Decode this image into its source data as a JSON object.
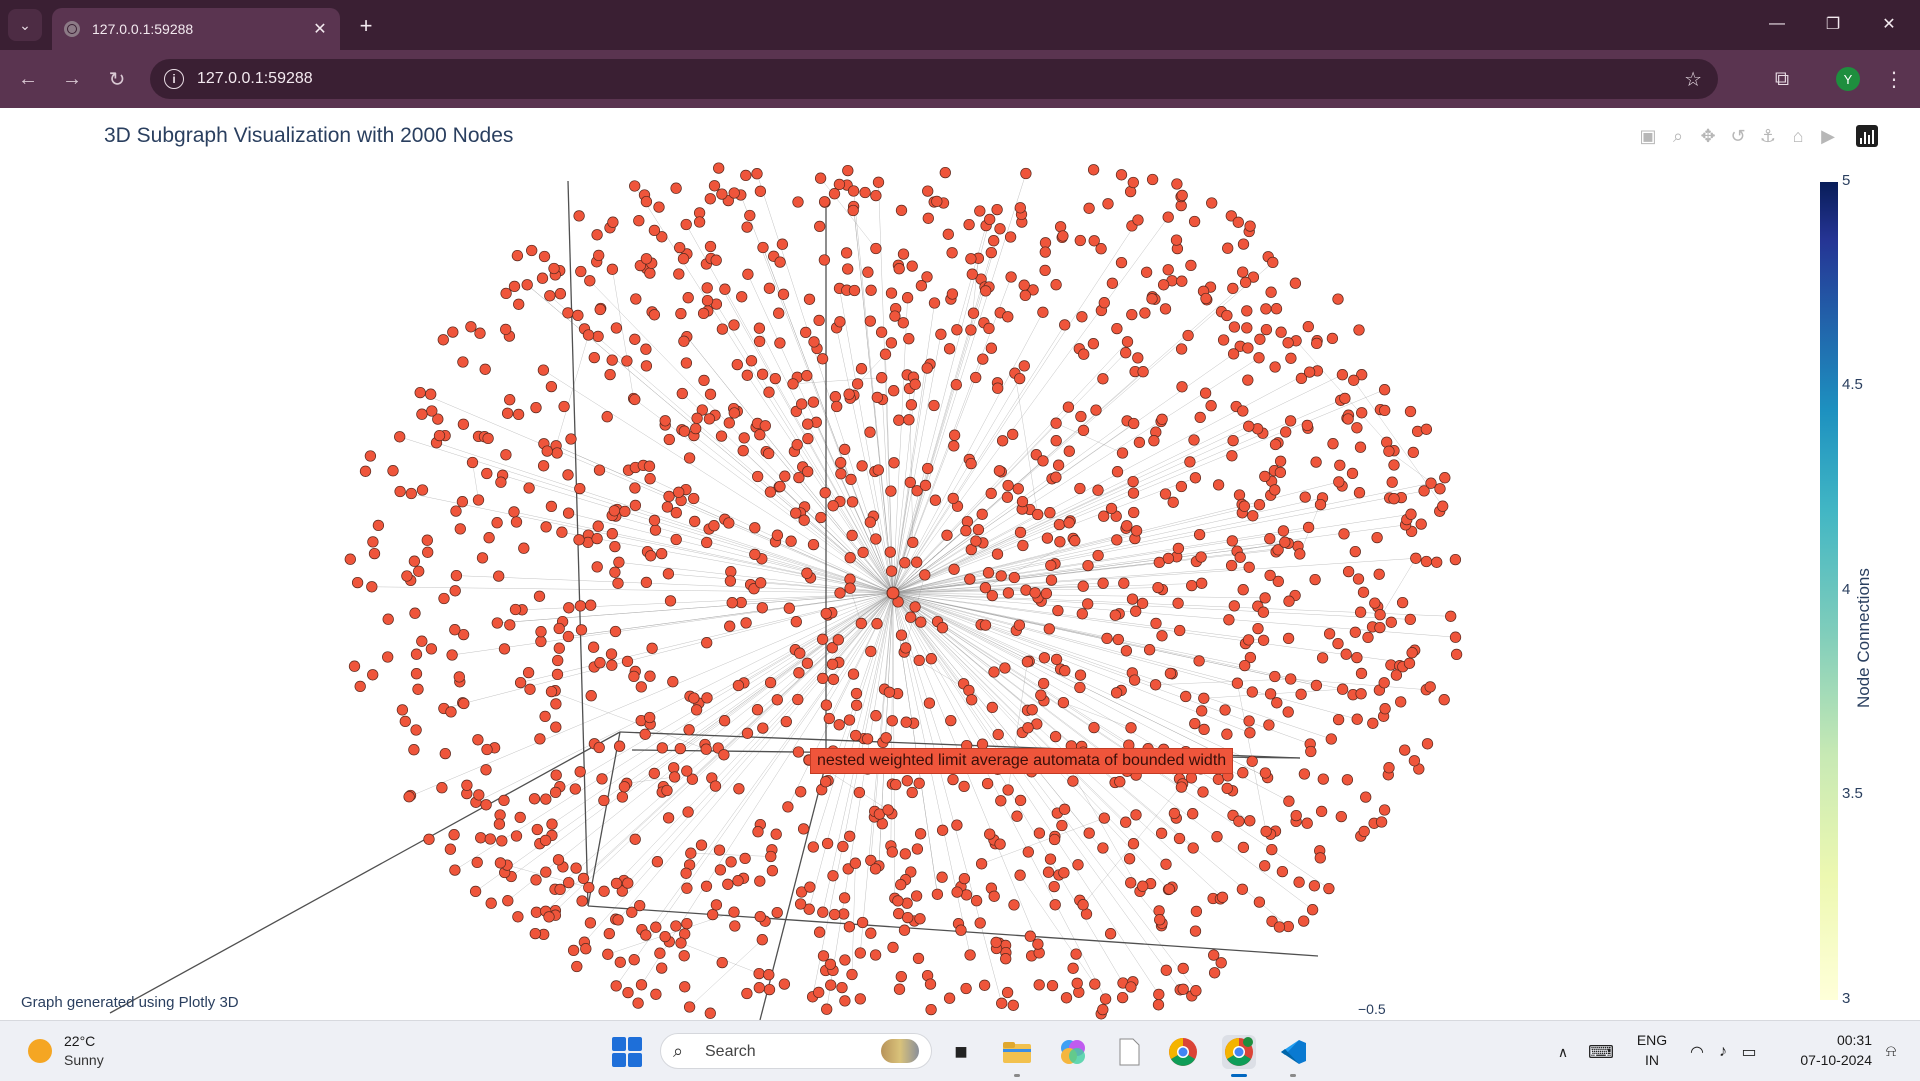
{
  "browser": {
    "tab_title": "127.0.0.1:59288",
    "url": "127.0.0.1:59288",
    "profile_initial": "Y"
  },
  "plot": {
    "title": "3D Subgraph Visualization with 2000 Nodes",
    "hover_label": "nested weighted limit average automata of bounded width",
    "annotation": "Graph generated using Plotly 3D",
    "colorbar": {
      "title": "Node Connections",
      "ticks": [
        "5",
        "4.5",
        "4",
        "3.5",
        "3"
      ],
      "range": [
        3,
        5
      ],
      "colorscale": "YlGnBu"
    },
    "axis_tick_label": "−0.5",
    "node_color": "#ef553b",
    "edge_color": "#9a9a9a"
  },
  "chart_data": {
    "type": "scatter",
    "title": "3D Subgraph Visualization with 2000 Nodes",
    "node_count": 2000,
    "marker_color": "#ef553b",
    "colorbar_title": "Node Connections",
    "colorbar_range": [
      3,
      5
    ],
    "colorbar_ticks": [
      3,
      3.5,
      4,
      4.5,
      5
    ],
    "hub_label": "nested weighted limit average automata of bounded width"
  },
  "taskbar": {
    "weather_temp": "22°C",
    "weather_desc": "Sunny",
    "search_label": "Search",
    "lang_top": "ENG",
    "lang_bottom": "IN",
    "time": "00:31",
    "date": "07-10-2024"
  }
}
